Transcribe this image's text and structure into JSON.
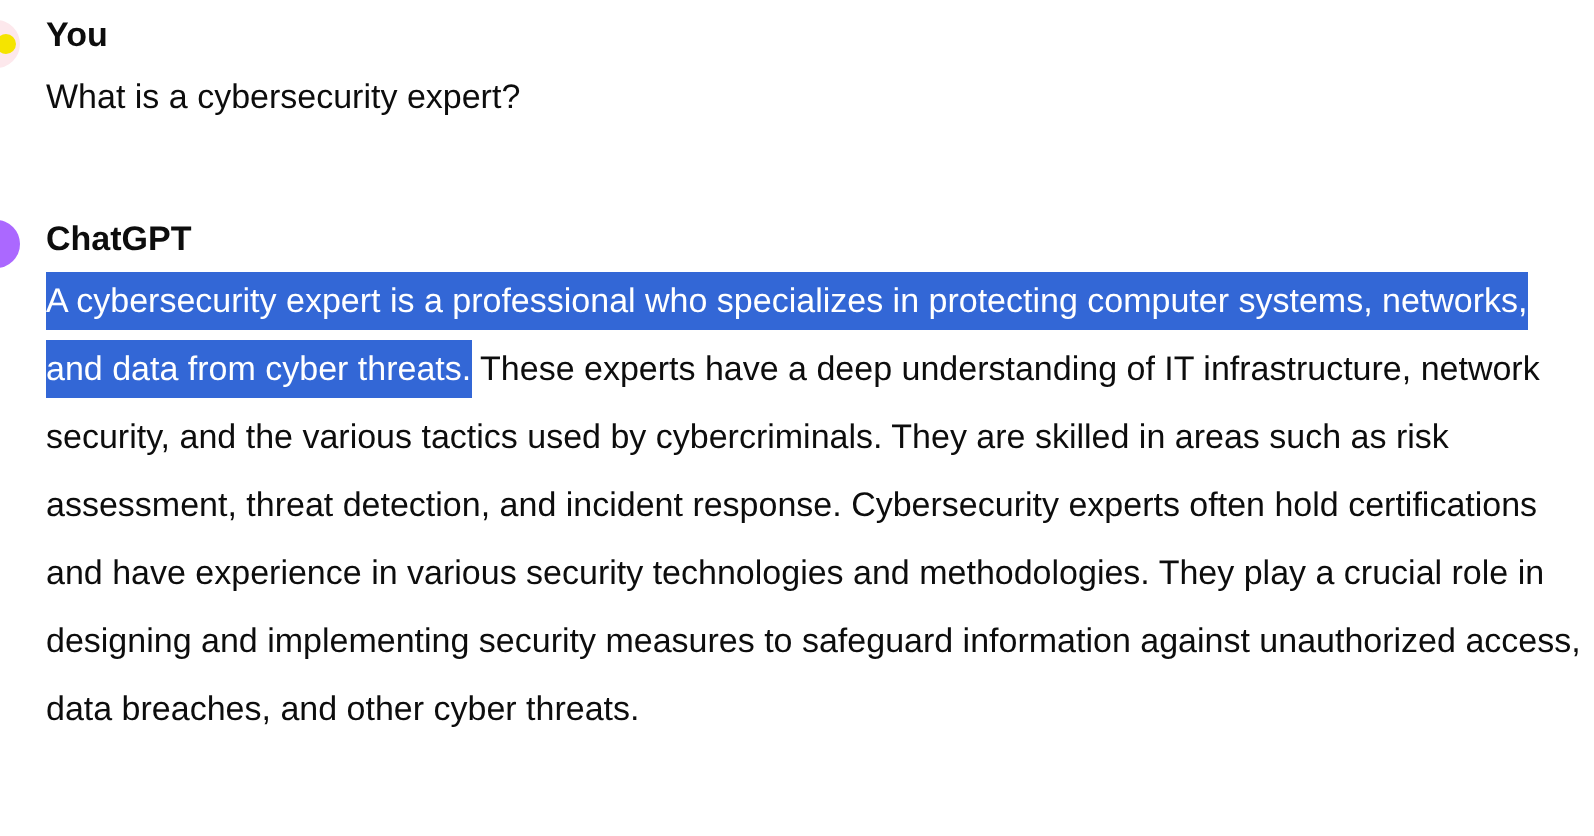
{
  "messages": [
    {
      "author": "You",
      "kind": "user",
      "segments": [
        {
          "text": "What is a cybersecurity expert?",
          "selected": false
        }
      ]
    },
    {
      "author": "ChatGPT",
      "kind": "assistant",
      "segments": [
        {
          "text": "A cybersecurity expert is a professional who specializes in protecting computer systems, networks, and data from cyber threats.",
          "selected": true
        },
        {
          "text": " These experts have a deep understanding of IT infrastructure, network security, and the various tactics used by cybercriminals. They are skilled in areas such as risk assessment, threat detection, and incident response. Cybersecurity experts often hold certifications and have experience in various security technologies and methodologies. They play a crucial role in designing and implementing security measures to safeguard information against unauthorized access, data breaches, and other cyber threats.",
          "selected": false
        }
      ]
    }
  ]
}
